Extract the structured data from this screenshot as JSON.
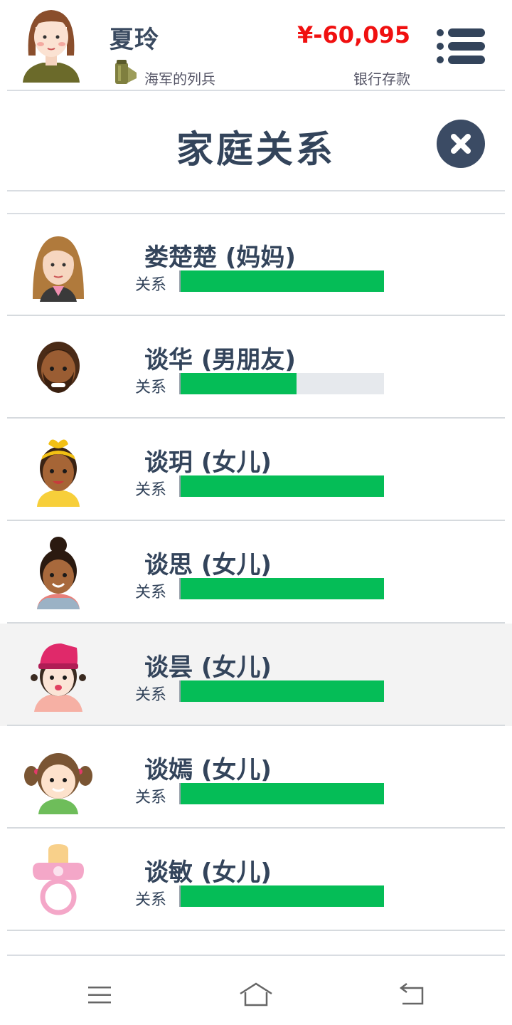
{
  "player": {
    "name": "夏玲",
    "job_title": "海军的列兵",
    "money": "¥-60,095",
    "money_label": "银行存款"
  },
  "dialog": {
    "title": "家庭关系"
  },
  "relationships": [
    {
      "name": "娄楚楚 (妈妈)",
      "label": "关系",
      "level": 1.0,
      "avatar": "mother-avatar-icon"
    },
    {
      "name": "谈华 (男朋友)",
      "label": "关系",
      "level": 0.57,
      "avatar": "boyfriend-avatar-icon"
    },
    {
      "name": "谈玥 (女儿)",
      "label": "关系",
      "level": 1.0,
      "avatar": "daughter-headband-avatar-icon"
    },
    {
      "name": "谈思 (女儿)",
      "label": "关系",
      "level": 1.0,
      "avatar": "daughter-bun-avatar-icon"
    },
    {
      "name": "谈昙 (女儿)",
      "label": "关系",
      "level": 1.0,
      "avatar": "daughter-pink-hat-avatar-icon"
    },
    {
      "name": "谈嫣 (女儿)",
      "label": "关系",
      "level": 1.0,
      "avatar": "daughter-pigtails-avatar-icon"
    },
    {
      "name": "谈敏 (女儿)",
      "label": "关系",
      "level": 1.0,
      "avatar": "baby-pacifier-icon"
    }
  ],
  "colors": {
    "accent_text": "#33445b",
    "money": "#f01010",
    "bar_fill": "#05bd57",
    "bar_track": "#e6e9ed",
    "close_button": "#3b4b64"
  },
  "icons": {
    "menu": "hamburger-list-icon",
    "close": "close-x-icon",
    "job": "military-canister-icon",
    "nav_menu": "menu-icon",
    "nav_home": "home-icon",
    "nav_back": "back-icon"
  }
}
